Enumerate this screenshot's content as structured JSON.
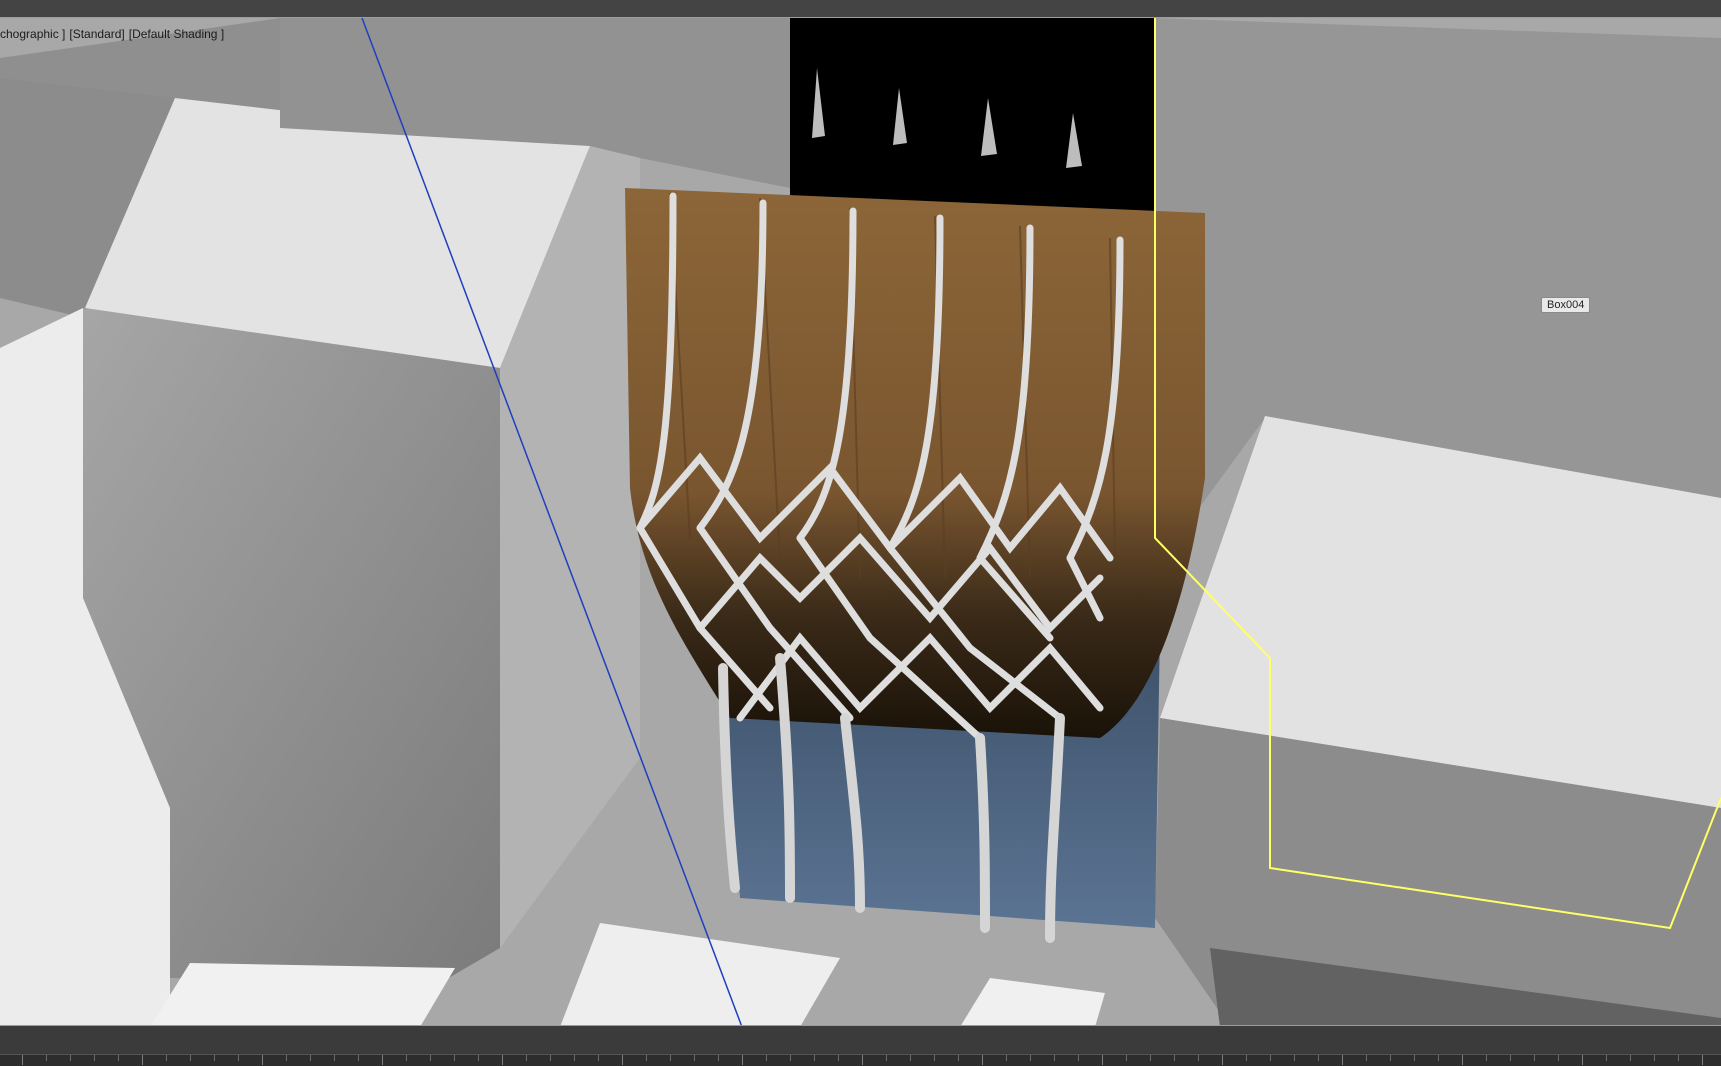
{
  "viewport": {
    "label_segments": [
      "chographic ]",
      "[Standard]",
      "[Default Shading ]"
    ],
    "object_tag": "Box004"
  },
  "colors": {
    "timeline_bg": "#3b3b3b",
    "selection_outline": "#ffff66",
    "axis_line": "#1f3fbf",
    "cladding_bronze": "#8a6436",
    "glass_blue": "#5a7090",
    "mullion_white": "#dcdcdc"
  },
  "icons": [
    "selection-bracket-icon"
  ]
}
